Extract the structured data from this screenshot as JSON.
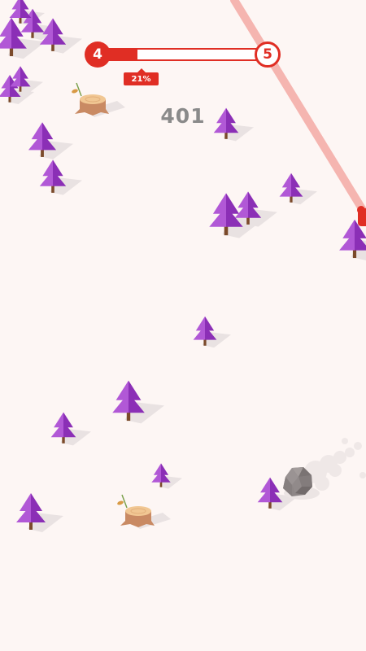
{
  "hud": {
    "level_current": "4",
    "level_next": "5",
    "progress_percent_label": "21%",
    "progress_fraction": 0.21,
    "score": "401"
  },
  "colors": {
    "background": "#fdf6f4",
    "accent": "#e02e24",
    "tree_light": "#b158d6",
    "tree_dark": "#8b2fb6",
    "trunk": "#7b4a2a",
    "shadow": "#e9e2e2",
    "stump_top": "#f1c793",
    "stump_side": "#c98a63",
    "boulder": "#8d8686"
  },
  "icons": {
    "tree": "pine-tree-icon",
    "stump": "tree-stump-icon",
    "boulder": "boulder-icon"
  }
}
